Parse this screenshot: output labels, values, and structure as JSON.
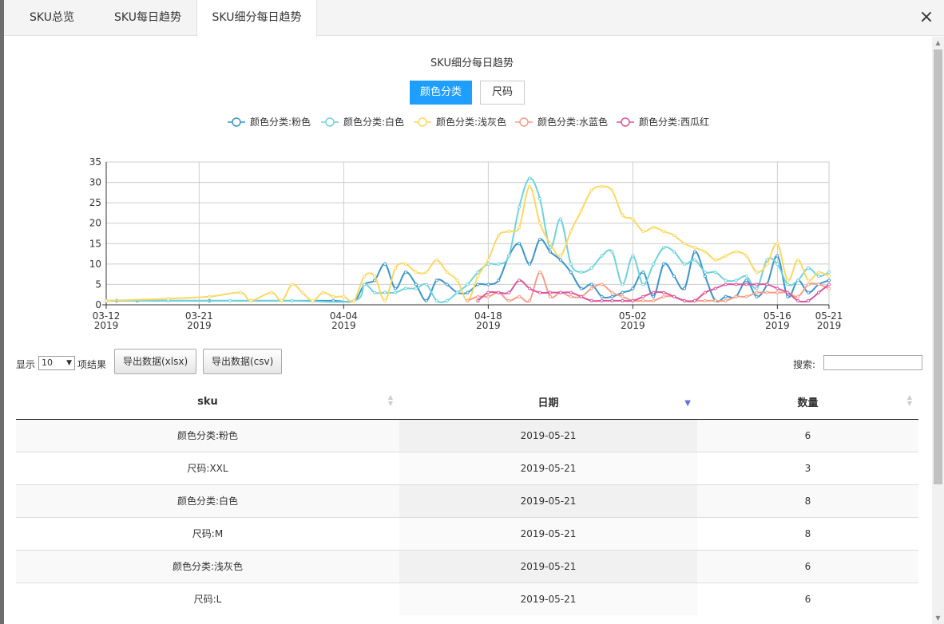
{
  "tabs": [
    {
      "label": "SKU总览"
    },
    {
      "label": "SKU每日趋势"
    },
    {
      "label": "SKU细分每日趋势"
    }
  ],
  "close_label": "×",
  "chart_title": "SKU细分每日趋势",
  "toggle": {
    "color_label": "颜色分类",
    "size_label": "尺码"
  },
  "controls": {
    "show_label": "显示",
    "page_size": "10",
    "suffix_label": "项结果",
    "export_xlsx": "导出数据(xlsx)",
    "export_csv": "导出数据(csv)",
    "search_label": "搜索:"
  },
  "table": {
    "headers": [
      "sku",
      "日期",
      "数量"
    ],
    "rows": [
      [
        "颜色分类:粉色",
        "2019-05-21",
        "6"
      ],
      [
        "尺码:XXL",
        "2019-05-21",
        "3"
      ],
      [
        "颜色分类:白色",
        "2019-05-21",
        "8"
      ],
      [
        "尺码:M",
        "2019-05-21",
        "8"
      ],
      [
        "颜色分类:浅灰色",
        "2019-05-21",
        "6"
      ],
      [
        "尺码:L",
        "2019-05-21",
        "6"
      ]
    ]
  },
  "chart_data": {
    "type": "line",
    "title": "SKU细分每日趋势",
    "xlabel": "",
    "ylabel": "",
    "x_range_days": [
      0,
      70
    ],
    "ylim": [
      0,
      35
    ],
    "y_ticks": [
      0,
      5,
      10,
      15,
      20,
      25,
      30,
      35
    ],
    "x_ticks": [
      {
        "day": 0,
        "label1": "03-12",
        "label2": "2019"
      },
      {
        "day": 9,
        "label1": "03-21",
        "label2": "2019"
      },
      {
        "day": 23,
        "label1": "04-04",
        "label2": "2019"
      },
      {
        "day": 37,
        "label1": "04-18",
        "label2": "2019"
      },
      {
        "day": 51,
        "label1": "05-02",
        "label2": "2019"
      },
      {
        "day": 65,
        "label1": "05-16",
        "label2": "2019"
      },
      {
        "day": 70,
        "label1": "05-21",
        "label2": "2019"
      }
    ],
    "grid": true,
    "legend_position": "top",
    "series": [
      {
        "name": "颜色分类:粉色",
        "color": "#3c96c9",
        "points": [
          [
            0,
            1
          ],
          [
            1,
            1
          ],
          [
            3,
            1
          ],
          [
            6,
            1
          ],
          [
            10,
            1
          ],
          [
            14,
            1
          ],
          [
            18,
            1
          ],
          [
            22,
            1
          ],
          [
            24,
            1
          ],
          [
            25,
            5
          ],
          [
            26,
            6
          ],
          [
            27,
            10
          ],
          [
            28,
            4
          ],
          [
            29,
            8
          ],
          [
            30,
            5
          ],
          [
            31,
            1
          ],
          [
            32,
            6
          ],
          [
            33,
            5
          ],
          [
            34,
            3
          ],
          [
            35,
            3
          ],
          [
            36,
            5
          ],
          [
            37,
            5
          ],
          [
            38,
            6
          ],
          [
            39,
            12
          ],
          [
            40,
            15
          ],
          [
            41,
            10
          ],
          [
            42,
            16
          ],
          [
            43,
            13
          ],
          [
            44,
            11
          ],
          [
            45,
            8
          ],
          [
            46,
            4
          ],
          [
            47,
            5
          ],
          [
            48,
            2
          ],
          [
            49,
            2
          ],
          [
            50,
            3
          ],
          [
            51,
            4
          ],
          [
            52,
            8
          ],
          [
            53,
            2
          ],
          [
            54,
            10
          ],
          [
            55,
            7
          ],
          [
            56,
            4
          ],
          [
            57,
            13
          ],
          [
            58,
            7
          ],
          [
            59,
            1
          ],
          [
            60,
            2
          ],
          [
            61,
            2
          ],
          [
            62,
            6
          ],
          [
            63,
            2
          ],
          [
            64,
            5
          ],
          [
            65,
            12
          ],
          [
            66,
            2
          ],
          [
            67,
            6
          ],
          [
            68,
            3
          ],
          [
            69,
            5
          ],
          [
            70,
            6
          ]
        ]
      },
      {
        "name": "颜色分类:白色",
        "color": "#6fd3dc",
        "points": [
          [
            0,
            1
          ],
          [
            6,
            1
          ],
          [
            12,
            1
          ],
          [
            18,
            1
          ],
          [
            24,
            1
          ],
          [
            25,
            5
          ],
          [
            26,
            3
          ],
          [
            27,
            3
          ],
          [
            28,
            3
          ],
          [
            29,
            4
          ],
          [
            30,
            4
          ],
          [
            31,
            5
          ],
          [
            32,
            1
          ],
          [
            33,
            1
          ],
          [
            34,
            3
          ],
          [
            35,
            5
          ],
          [
            36,
            8
          ],
          [
            37,
            10
          ],
          [
            38,
            10
          ],
          [
            39,
            12
          ],
          [
            40,
            24
          ],
          [
            41,
            31
          ],
          [
            42,
            26
          ],
          [
            43,
            14
          ],
          [
            44,
            21
          ],
          [
            45,
            10
          ],
          [
            46,
            8
          ],
          [
            47,
            9
          ],
          [
            48,
            12
          ],
          [
            49,
            13
          ],
          [
            50,
            5
          ],
          [
            51,
            12
          ],
          [
            52,
            5
          ],
          [
            53,
            10
          ],
          [
            54,
            14
          ],
          [
            55,
            13
          ],
          [
            56,
            10
          ],
          [
            57,
            11
          ],
          [
            58,
            8
          ],
          [
            59,
            8
          ],
          [
            60,
            6
          ],
          [
            61,
            6
          ],
          [
            62,
            7
          ],
          [
            63,
            4
          ],
          [
            64,
            11
          ],
          [
            65,
            10
          ],
          [
            66,
            5
          ],
          [
            67,
            6
          ],
          [
            68,
            9
          ],
          [
            69,
            7
          ],
          [
            70,
            8
          ]
        ]
      },
      {
        "name": "颜色分类:浅灰色",
        "color": "#fbd862",
        "points": [
          [
            0,
            1
          ],
          [
            6,
            1.5
          ],
          [
            10,
            2
          ],
          [
            13,
            3
          ],
          [
            14,
            1
          ],
          [
            16,
            3
          ],
          [
            17,
            1
          ],
          [
            18,
            5
          ],
          [
            19,
            3
          ],
          [
            20,
            1
          ],
          [
            21,
            3
          ],
          [
            22,
            2
          ],
          [
            23,
            2
          ],
          [
            24,
            1
          ],
          [
            25,
            7
          ],
          [
            26,
            7
          ],
          [
            27,
            1
          ],
          [
            28,
            9
          ],
          [
            29,
            10
          ],
          [
            30,
            8
          ],
          [
            31,
            8
          ],
          [
            32,
            11
          ],
          [
            33,
            8
          ],
          [
            34,
            6
          ],
          [
            35,
            1
          ],
          [
            36,
            7
          ],
          [
            37,
            11
          ],
          [
            38,
            17
          ],
          [
            39,
            18
          ],
          [
            40,
            19
          ],
          [
            41,
            29
          ],
          [
            42,
            20
          ],
          [
            43,
            15
          ],
          [
            44,
            12
          ],
          [
            45,
            18
          ],
          [
            46,
            23
          ],
          [
            47,
            28
          ],
          [
            48,
            29
          ],
          [
            49,
            28
          ],
          [
            50,
            22
          ],
          [
            51,
            21
          ],
          [
            52,
            18
          ],
          [
            53,
            19
          ],
          [
            54,
            18
          ],
          [
            55,
            17
          ],
          [
            56,
            15
          ],
          [
            57,
            14
          ],
          [
            58,
            13
          ],
          [
            59,
            11
          ],
          [
            60,
            12
          ],
          [
            61,
            13
          ],
          [
            62,
            12
          ],
          [
            63,
            8
          ],
          [
            64,
            10
          ],
          [
            65,
            15
          ],
          [
            66,
            6
          ],
          [
            67,
            11
          ],
          [
            68,
            6
          ],
          [
            69,
            8
          ],
          [
            70,
            7
          ]
        ]
      },
      {
        "name": "颜色分类:水蓝色",
        "color": "#f79d87",
        "points": [
          [
            35,
            1
          ],
          [
            36,
            2
          ],
          [
            37,
            2
          ],
          [
            38,
            3
          ],
          [
            39,
            1
          ],
          [
            40,
            2
          ],
          [
            41,
            1
          ],
          [
            42,
            8
          ],
          [
            43,
            2
          ],
          [
            44,
            3
          ],
          [
            45,
            2
          ],
          [
            46,
            2
          ],
          [
            47,
            4
          ],
          [
            48,
            5
          ],
          [
            49,
            3
          ],
          [
            50,
            2
          ],
          [
            51,
            1
          ],
          [
            52,
            1
          ],
          [
            53,
            1
          ],
          [
            54,
            2
          ],
          [
            55,
            2
          ],
          [
            56,
            1
          ],
          [
            57,
            1
          ],
          [
            58,
            1
          ],
          [
            59,
            1
          ],
          [
            60,
            1
          ],
          [
            61,
            2
          ],
          [
            62,
            2
          ],
          [
            63,
            3
          ],
          [
            64,
            3
          ],
          [
            65,
            3
          ],
          [
            66,
            3
          ],
          [
            67,
            2
          ],
          [
            68,
            5
          ],
          [
            69,
            5
          ],
          [
            70,
            4
          ]
        ]
      },
      {
        "name": "颜色分类:西瓜红",
        "color": "#d9559f",
        "points": [
          [
            36,
            1
          ],
          [
            37,
            3
          ],
          [
            38,
            3
          ],
          [
            39,
            3
          ],
          [
            40,
            6
          ],
          [
            41,
            4
          ],
          [
            42,
            3
          ],
          [
            43,
            3
          ],
          [
            44,
            3
          ],
          [
            45,
            3
          ],
          [
            46,
            2
          ],
          [
            47,
            1
          ],
          [
            48,
            1
          ],
          [
            49,
            1
          ],
          [
            50,
            1
          ],
          [
            51,
            1
          ],
          [
            52,
            2
          ],
          [
            53,
            3
          ],
          [
            54,
            3
          ],
          [
            55,
            2
          ],
          [
            56,
            1
          ],
          [
            57,
            1
          ],
          [
            58,
            3
          ],
          [
            59,
            4
          ],
          [
            60,
            5
          ],
          [
            61,
            5
          ],
          [
            62,
            5
          ],
          [
            63,
            5
          ],
          [
            64,
            5
          ],
          [
            65,
            4
          ],
          [
            66,
            3
          ],
          [
            67,
            1
          ],
          [
            68,
            1
          ],
          [
            69,
            3
          ],
          [
            70,
            5
          ]
        ]
      }
    ]
  }
}
